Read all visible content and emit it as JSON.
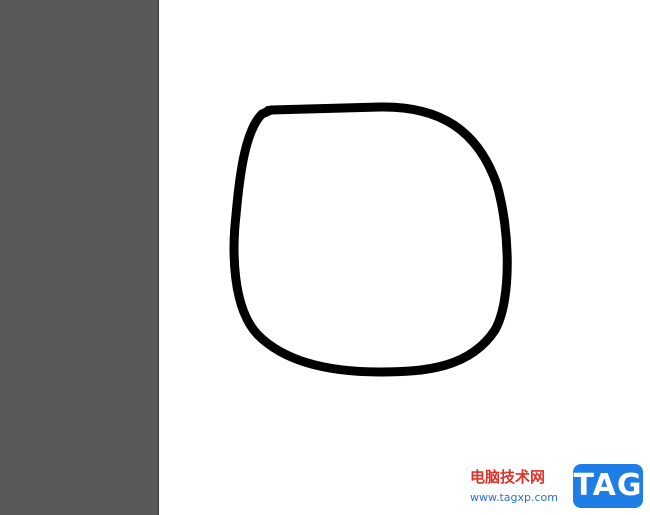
{
  "canvas": {
    "pasteboard_color": "#595959",
    "artboard_color": "#ffffff",
    "stroke_color": "#000000",
    "shape": "closed-rounded-path"
  },
  "watermark": {
    "site_name": "电脑技术网",
    "url": "www.tagxp.com",
    "badge_text": "TAG",
    "badge_color": "#1f7ee6",
    "site_color": "#e0322b",
    "url_color": "#2e6fd1"
  }
}
